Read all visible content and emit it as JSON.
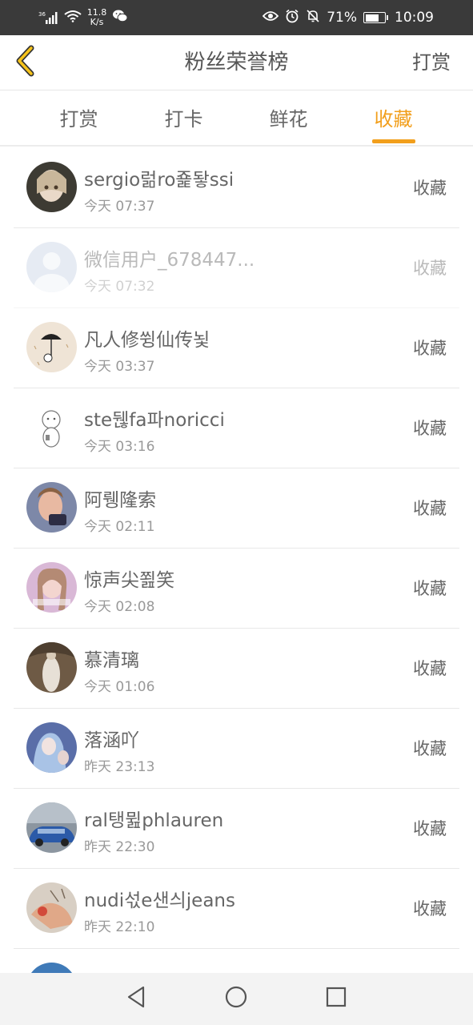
{
  "status_bar": {
    "signal_label": "36",
    "net_speed_value": "11.8",
    "net_speed_unit": "K/s",
    "battery": "71%",
    "battery_level": 0.71,
    "time": "10:09"
  },
  "header": {
    "title": "粉丝荣誉榜",
    "right_link": "打赏"
  },
  "tabs": [
    {
      "label": "打赏",
      "active": false
    },
    {
      "label": "打卡",
      "active": false
    },
    {
      "label": "鲜花",
      "active": false
    },
    {
      "label": "收藏",
      "active": true
    }
  ],
  "colors": {
    "accent": "#f29f1c",
    "status_bar_bg": "#3a3a3a"
  },
  "list": [
    {
      "name": "sergio럶ro죭돻ssi",
      "time": "今天 07:37",
      "action": "收藏"
    },
    {
      "name": "微信用户_678447...",
      "time": "今天 07:32",
      "action": "收藏"
    },
    {
      "name": "凡人修쓍仙传뇣",
      "time": "今天 03:37",
      "action": "收藏"
    },
    {
      "name": "ste뒎fa파noricci",
      "time": "今天 03:16",
      "action": "收藏"
    },
    {
      "name": "阿뤵隆索",
      "time": "今天 02:11",
      "action": "收藏"
    },
    {
      "name": "惊声尖쬞笑",
      "time": "今天 02:08",
      "action": "收藏"
    },
    {
      "name": "慕清璃",
      "time": "今天 01:06",
      "action": "收藏"
    },
    {
      "name": "落涵吖",
      "time": "昨天 23:13",
      "action": "收藏"
    },
    {
      "name": "ral탱뮖phlauren",
      "time": "昨天 22:30",
      "action": "收藏"
    },
    {
      "name": "nudi섟e샌싀jeans",
      "time": "昨天 22:10",
      "action": "收藏"
    },
    {
      "name": "",
      "time": "",
      "action": ""
    }
  ]
}
